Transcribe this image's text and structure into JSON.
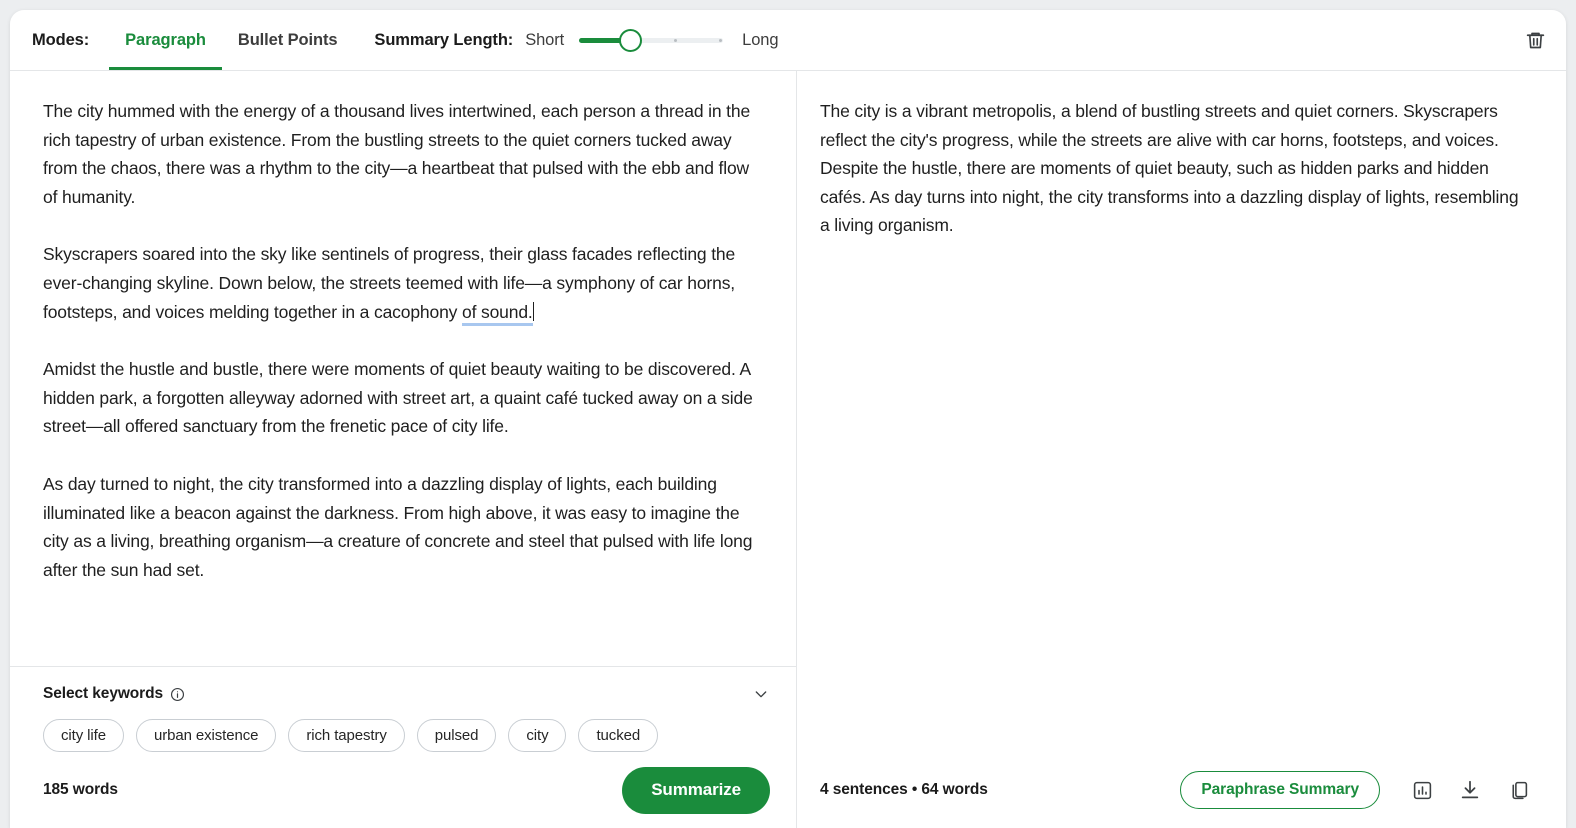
{
  "toolbar": {
    "modes_label": "Modes:",
    "tabs": [
      {
        "label": "Paragraph",
        "active": true
      },
      {
        "label": "Bullet Points",
        "active": false
      }
    ],
    "summary_length_label": "Summary Length:",
    "slider": {
      "min_label": "Short",
      "max_label": "Long",
      "ticks": 4,
      "value_index": 1,
      "fill_percent": 36
    },
    "delete_icon": "trash-icon"
  },
  "colors": {
    "accent_green": "#1a8c3c",
    "suggestion_underline": "#a8c7ef",
    "border": "#e4e6e8",
    "page_background": "#eceef0"
  },
  "editor": {
    "paragraphs": [
      "The city hummed with the energy of a thousand lives intertwined, each person a thread in the rich tapestry of urban existence. From the bustling streets to the quiet corners tucked away from the chaos, there was a rhythm to the city—a heartbeat that pulsed with the ebb and flow of humanity.",
      "Skyscrapers soared into the sky like sentinels of progress, their glass facades reflecting the ever-changing skyline. Down below, the streets teemed with life—a symphony of car horns, footsteps, and voices melding together in a cacophony ",
      "Amidst the hustle and bustle, there were moments of quiet beauty waiting to be discovered. A hidden park, a forgotten alleyway adorned with street art, a quaint café tucked away on a side street—all offered sanctuary from the frenetic pace of city life.",
      "As day turned to night, the city transformed into a dazzling display of lights, each building illuminated like a beacon against the darkness. From high above, it was easy to imagine the city as a living, breathing organism—a creature of concrete and steel that pulsed with life long after the sun had set."
    ],
    "suggestion_text": "of sound."
  },
  "keywords": {
    "title": "Select keywords",
    "info_icon": "info-circle-icon",
    "collapse_icon": "chevron-down-icon",
    "chips": [
      "city life",
      "urban existence",
      "rich tapestry",
      "pulsed",
      "city",
      "tucked"
    ]
  },
  "left_footer": {
    "word_count": "185 words",
    "summarize_label": "Summarize"
  },
  "summary": {
    "text": "The city is a vibrant metropolis, a blend of bustling streets and quiet corners. Skyscrapers reflect the city's progress, while the streets are alive with car horns, footsteps, and voices. Despite the hustle, there are moments of quiet beauty, such as hidden parks and hidden cafés. As day turns into night, the city transforms into a dazzling display of lights, resembling a living organism."
  },
  "right_footer": {
    "stats": "4 sentences • 64 words",
    "paraphrase_label": "Paraphrase Summary",
    "icons": [
      "bar-chart-icon",
      "download-icon",
      "copy-icon"
    ]
  }
}
